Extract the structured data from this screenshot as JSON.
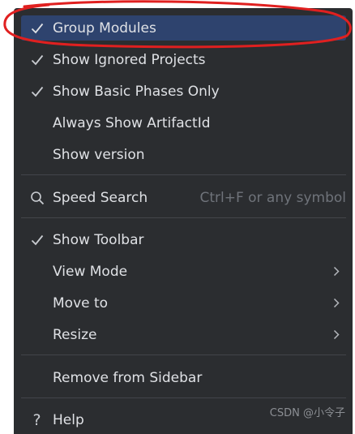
{
  "menu": {
    "items": [
      {
        "label": "Group Modules",
        "checked": true
      },
      {
        "label": "Show Ignored Projects",
        "checked": true
      },
      {
        "label": "Show Basic Phases Only",
        "checked": true
      },
      {
        "label": "Always Show ArtifactId",
        "checked": false
      },
      {
        "label": "Show version",
        "checked": false
      }
    ],
    "speed_search": {
      "label": "Speed Search",
      "shortcut": "Ctrl+F or any symbol",
      "icon": "search-icon"
    },
    "view_items": [
      {
        "label": "Show Toolbar",
        "checked": true
      },
      {
        "label": "View Mode",
        "submenu": true
      },
      {
        "label": "Move to",
        "submenu": true
      },
      {
        "label": "Resize",
        "submenu": true
      }
    ],
    "remove": {
      "label": "Remove from Sidebar"
    },
    "help": {
      "label": "Help",
      "icon": "question-mark-icon"
    }
  },
  "watermark": "CSDN @小令子",
  "colors": {
    "menu_bg": "#2b2d30",
    "selected_bg": "#2e436e",
    "text": "#dfe1e5",
    "shortcut_text": "#6f737a",
    "annotation": "#e02020"
  }
}
